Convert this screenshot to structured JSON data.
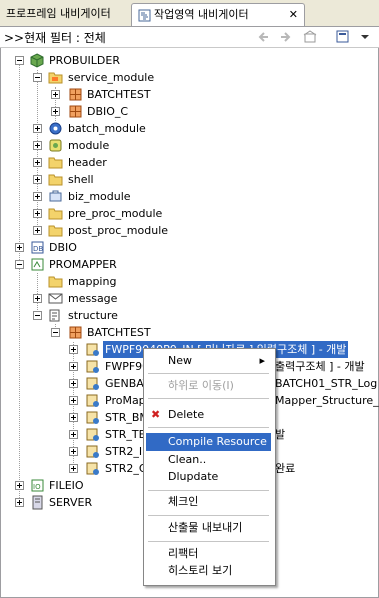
{
  "tabs": {
    "inactive_label": "프로프레임 내비게이터",
    "active_label": "작업영역 내비게이터",
    "close_glyph": "✕"
  },
  "toolbar": {
    "filter_text": ">>현재 필터 : 전체"
  },
  "tree": {
    "probuilder": "PROBUILDER",
    "service_module": "service_module",
    "batchtest": "BATCHTEST",
    "dbio_c": "DBIO_C",
    "batch_module": "batch_module",
    "module": "module",
    "header": "header",
    "shell": "shell",
    "biz_module": "biz_module",
    "pre_proc_module": "pre_proc_module",
    "post_proc_module": "post_proc_module",
    "dbio": "DBIO",
    "promapper": "PROMAPPER",
    "mapping": "mapping",
    "message": "message",
    "structure": "structure",
    "batchtest2": "BATCHTEST",
    "r1": "FWPF9040P0_IN [ 미니자료 ] 입력구조체 ] - 개발",
    "r2a": "FWPF90",
    "r2b": "출력구조체 ] - 개발",
    "r3a": "GENBAT",
    "r3b": "BATCH01_STR_Log",
    "r4a": "ProMapp",
    "r4b": "Mapper_Structure_S",
    "r5a": "STR_BM",
    "r6a": "STR_TE",
    "r6b": "발",
    "r7a": "STR2_IN",
    "r8a": "STR2_O",
    "r8b": "완료",
    "fileio": "FILEIO",
    "server": "SERVER"
  },
  "context_menu": {
    "new": "New",
    "move_down": "하위로 이동(I)",
    "delete": "Delete",
    "compile": "Compile Resource",
    "clean": "Clean..",
    "dlupdate": "Dlupdate",
    "checkin": "체크인",
    "export": "산출물 내보내기",
    "refactor": "리팩터",
    "history": "히스토리 보기"
  },
  "colors": {
    "selection": "#316ac5",
    "background": "#ece9d8"
  }
}
